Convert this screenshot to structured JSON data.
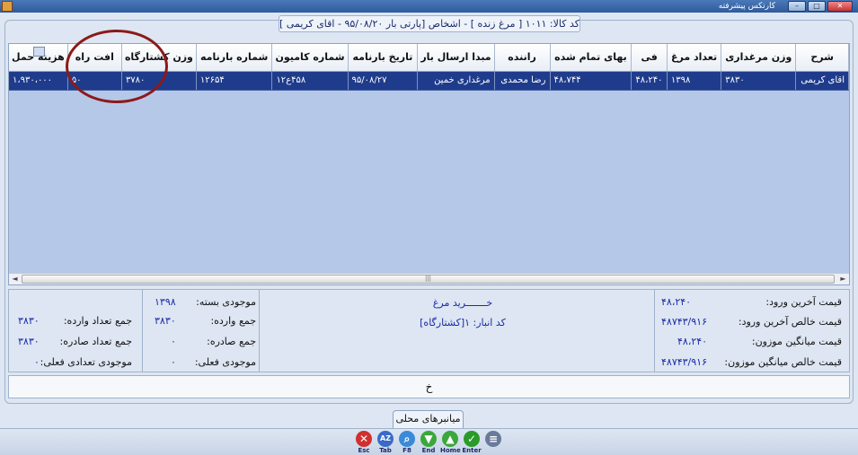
{
  "window": {
    "title": "کارتکس پیشرفته",
    "minimize": "–",
    "maximize": "□",
    "close": "✕"
  },
  "caption": "کد کالا: ۱۰۱۱ [ مرغ زنده ] - اشخاص [پارتی بار ۹۵/۰۸/۲۰ - اقای کریمی ]",
  "grid": {
    "columns": [
      "هزینه حمل",
      "افت راه",
      "وزن کشتارگاه",
      "شماره بارنامه",
      "شماره کامیون",
      "تاریخ بارنامه",
      "مبدا ارسال بار",
      "راننده",
      "بهای تمام شده",
      "فی",
      "تعداد مرغ",
      "وزن مرغداری",
      "شرح"
    ],
    "row": [
      "۱،۹۳۰،۰۰۰",
      "۵۰",
      "۳۷۸۰",
      "۱۲۶۵۴",
      "۴۵۸ع۱۲",
      "۹۵/۰۸/۲۷",
      "مرغداری خمین",
      "رضا محمدی",
      "۴۸،۷۴۴",
      "۴۸،۲۴۰",
      "۱۳۹۸",
      "۳۸۳۰",
      "اقای کریمی"
    ],
    "scroll_grip": "|||"
  },
  "info": {
    "left": [
      {
        "label": "جمع تعداد وارده:",
        "value": "۳۸۳۰"
      },
      {
        "label": "جمع تعداد صادره:",
        "value": "۳۸۳۰"
      },
      {
        "label": "موجودی تعدادی فعلی:",
        "value": "۰"
      }
    ],
    "midleft": [
      {
        "label": "موجودی بسته:",
        "value": "۱۳۹۸"
      },
      {
        "label": "جمع وارده:",
        "value": "۳۸۳۰"
      },
      {
        "label": "جمع صادره:",
        "value": "۰"
      },
      {
        "label": "موجودی فعلی:",
        "value": "۰"
      }
    ],
    "center_title": "خـــــــرید مرغ",
    "center_sub": "کد انبار: ۱[کشتارگاه]",
    "right": [
      {
        "label": "قیمت آخرین ورود:",
        "value": "۴۸،۲۴۰"
      },
      {
        "label": "قیمت خالص آخرین ورود:",
        "value": "۴۸۷۴۳/۹۱۶"
      },
      {
        "label": "قیمت میانگین موزون:",
        "value": "۴۸،۲۴۰"
      },
      {
        "label": "قیمت خالص میانگین موزون:",
        "value": "۴۸۷۴۳/۹۱۶"
      }
    ]
  },
  "bottom_field": "خ",
  "tab_label": "میانبرهای محلی",
  "toolbar": [
    {
      "caption": "Esc",
      "glyph": "✕",
      "color": "#d03030"
    },
    {
      "caption": "Tab",
      "glyph": "AZ",
      "color": "#3a6ac8"
    },
    {
      "caption": "F8",
      "glyph": "⌕",
      "color": "#3a8ad8"
    },
    {
      "caption": "End",
      "glyph": "▼",
      "color": "#3aa83a"
    },
    {
      "caption": "Home",
      "glyph": "▲",
      "color": "#3aa83a"
    },
    {
      "caption": "Enter",
      "glyph": "✓",
      "color": "#2a9a2a"
    },
    {
      "caption": "",
      "glyph": "≡",
      "color": "#6a7a9a"
    }
  ]
}
